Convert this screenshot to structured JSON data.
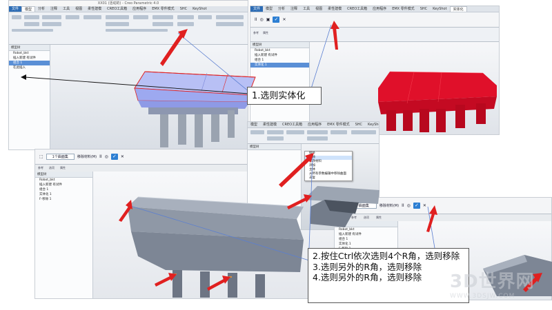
{
  "app": {
    "window_title": "XX01 (活动的) - Creo Parametric 4.0",
    "tabs_panel1": [
      "文件",
      "模型",
      "分析",
      "注释",
      "工具",
      "视图",
      "柔性建模",
      "CREO工具箱",
      "应用程序",
      "EMX 零件模式",
      "SHC",
      "KeyShot"
    ],
    "tabs_panel2": [
      "文件",
      "模型",
      "分析",
      "注释",
      "工具",
      "视图",
      "柔性建模",
      "CREO工具箱",
      "应用程序",
      "EMX 零件模式",
      "SHC",
      "KeyShot",
      "实体化"
    ],
    "tabs_panel3": [
      "模型",
      "柔性建模",
      "CREO工具箱",
      "应用程序",
      "EMX 零件模式",
      "SHC",
      "KeyShot"
    ],
    "active_tab": "模型"
  },
  "tree": {
    "header": "模型树",
    "root": "Robot_bkt",
    "nodes": [
      "RIGHT",
      "插入新建 有试件",
      "组合 1",
      "实体化 1",
      "在此插入"
    ],
    "panel3_nodes": [
      "Robot_bkt",
      "插入新建 有试件",
      "组合 1",
      "实体化 1",
      "F-移除 1"
    ],
    "small_nodes": [
      "Robot_bkt",
      "插入新建 有试件",
      "组合 1",
      "实体化 1",
      "F移除 1"
    ]
  },
  "dashboard": {
    "ref_label": "参考",
    "options_label": "选项",
    "props_label": "属性",
    "field_value": "1个曲面集",
    "chk_label": "移除材料(M)",
    "pause": "II",
    "ok": "✓",
    "cancel": "✕"
  },
  "context_menu": {
    "items": [
      "插补",
      "移除",
      "修改材料",
      "添加",
      "主体",
      "从所有参数编辑中移除曲面",
      "去复"
    ]
  },
  "callouts": {
    "step1": "1.选则实体化",
    "step2": "2.按住Ctrl依次选则4个R角，选则移除",
    "step3": "3.选则另外的R角，选则移除",
    "step4": "4.选则另外的R角，选则移除"
  },
  "watermark": {
    "text": "3D世界网",
    "url": "WWW.3DSJW.COM"
  },
  "colors": {
    "highlight_model": "#9da9f0",
    "solidified_model": "#e0102a",
    "gray_model": "#9aa3b0",
    "arrow_red": "#e02020",
    "leader_blue": "#5b7fd1",
    "ok_blue": "#2d7fd3"
  }
}
